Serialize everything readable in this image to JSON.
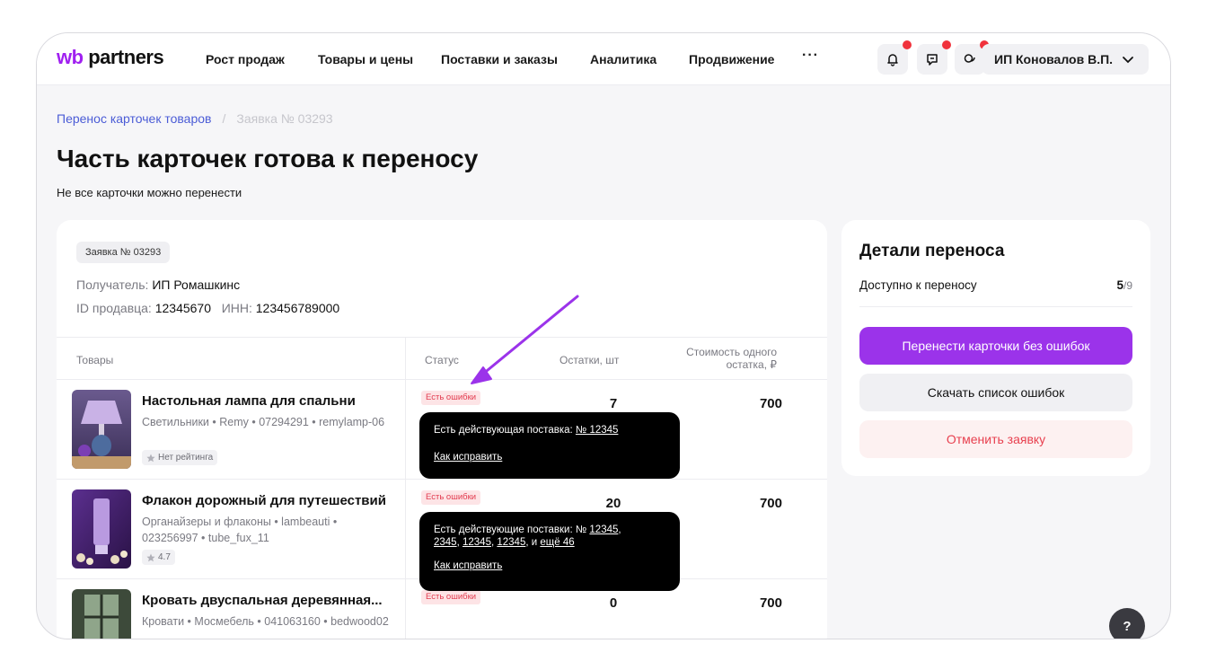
{
  "nav": {
    "logo_wb": "wb",
    "logo_partners": "partners",
    "items": [
      "Рост продаж",
      "Товары и цены",
      "Поставки и заказы",
      "Аналитика",
      "Продвижение"
    ],
    "more": "···",
    "user": "ИП Коновалов В.П."
  },
  "breadcrumb": {
    "link": "Перенос карточек товаров",
    "separator": "/",
    "current": "Заявка № 03293"
  },
  "page": {
    "title": "Часть карточек готова к переносу",
    "subtitle": "Не все карточки можно перенести"
  },
  "request": {
    "badge": "Заявка № 03293",
    "recipient_label": "Получатель:",
    "recipient": "ИП Ромашкинс",
    "seller_id_label": "ID продавца:",
    "seller_id": "12345670",
    "inn_label": "ИНН:",
    "inn": "123456789000"
  },
  "table": {
    "headers": {
      "products": "Товары",
      "status": "Статус",
      "stock": "Остатки, шт",
      "cost_line1": "Стоимость одного",
      "cost_line2": "остатка, ₽"
    },
    "rows": [
      {
        "name": "Настольная лампа для спальни",
        "meta": "Светильники • Remy • 07294291 • remylamp-06",
        "rating": "Нет рейтинга",
        "status": "Есть ошибки",
        "stock": "7",
        "cost": "700"
      },
      {
        "name": "Флакон дорожный для путешествий",
        "meta": "Органайзеры и флаконы • lambeauti • 023256997 • tube_fux_11",
        "rating": "4.7",
        "status": "Есть ошибки",
        "stock": "20",
        "cost": "700"
      },
      {
        "name": "Кровать двуспальная деревянная...",
        "meta": "Кровати • Мосмебель • 041063160 • bedwood02",
        "rating": "",
        "status": "Есть ошибки",
        "stock": "0",
        "cost": "700"
      }
    ]
  },
  "tooltips": [
    {
      "text": "Есть действующая поставка:",
      "links": [
        "№ 12345"
      ],
      "fix": "Как исправить"
    },
    {
      "text_line1": "Есть действующие поставки: №",
      "link1": "12345",
      "link2": "2345",
      "link3": "12345",
      "link4": "12345",
      "and": ", и",
      "more": "ещё 46",
      "fix": "Как исправить"
    }
  ],
  "details": {
    "title": "Детали переноса",
    "available_label": "Доступно к переносу",
    "available_value": "5",
    "available_total": "/9",
    "btn_transfer": "Перенести карточки без ошибок",
    "btn_download": "Скачать список ошибок",
    "btn_cancel": "Отменить заявку"
  },
  "help": "?",
  "colors": {
    "accent": "#9b33ea",
    "link": "#4b5cd6",
    "error": "#e23a4e",
    "notification_dot": "#f0323c"
  },
  "icons": [
    "bell-icon",
    "feedback-icon",
    "chat-icon",
    "chevron-down-icon",
    "star-icon",
    "arrow-annotation"
  ]
}
